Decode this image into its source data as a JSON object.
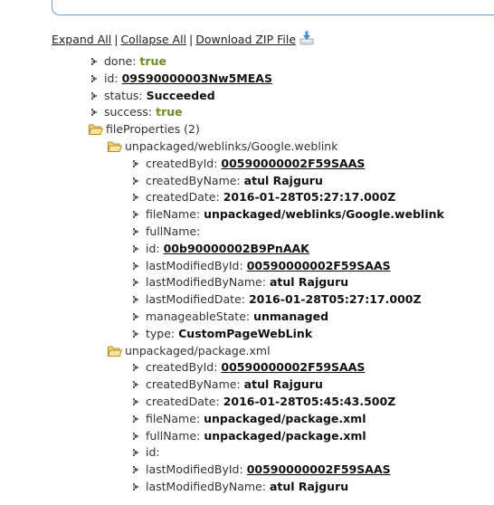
{
  "actions": {
    "expand_all": "Expand All",
    "separator": "|",
    "collapse_all": "Collapse All",
    "download_zip": "Download ZIP File",
    "download_icon": "download-tray-icon"
  },
  "result": {
    "done": {
      "key": "done:",
      "value": "true"
    },
    "id": {
      "key": "id:",
      "value": "09S90000003Nw5MEAS"
    },
    "status": {
      "key": "status:",
      "value": "Succeeded"
    },
    "success": {
      "key": "success:",
      "value": "true"
    },
    "fileProperties": {
      "label": "fileProperties (2)",
      "files": [
        {
          "name": "unpackaged/weblinks/Google.weblink",
          "props": [
            {
              "key": "createdById:",
              "value": "00590000002F59SAAS",
              "link": true
            },
            {
              "key": "createdByName:",
              "value": "atul Rajguru"
            },
            {
              "key": "createdDate:",
              "value": "2016-01-28T05:27:17.000Z"
            },
            {
              "key": "fileName:",
              "value": "unpackaged/weblinks/Google.weblink"
            },
            {
              "key": "fullName:",
              "value": ""
            },
            {
              "key": "id:",
              "value": "00b90000002B9PnAAK",
              "link": true
            },
            {
              "key": "lastModifiedById:",
              "value": "00590000002F59SAAS",
              "link": true
            },
            {
              "key": "lastModifiedByName:",
              "value": "atul Rajguru"
            },
            {
              "key": "lastModifiedDate:",
              "value": "2016-01-28T05:27:17.000Z"
            },
            {
              "key": "manageableState:",
              "value": "unmanaged"
            },
            {
              "key": "type:",
              "value": "CustomPageWebLink"
            }
          ]
        },
        {
          "name": "unpackaged/package.xml",
          "props": [
            {
              "key": "createdById:",
              "value": "00590000002F59SAAS",
              "link": true
            },
            {
              "key": "createdByName:",
              "value": "atul Rajguru"
            },
            {
              "key": "createdDate:",
              "value": "2016-01-28T05:45:43.500Z"
            },
            {
              "key": "fileName:",
              "value": "unpackaged/package.xml"
            },
            {
              "key": "fullName:",
              "value": "unpackaged/package.xml"
            },
            {
              "key": "id:",
              "value": ""
            },
            {
              "key": "lastModifiedById:",
              "value": "00590000002F59SAAS",
              "link": true
            },
            {
              "key": "lastModifiedByName:",
              "value": "atul Rajguru"
            }
          ]
        }
      ]
    }
  }
}
